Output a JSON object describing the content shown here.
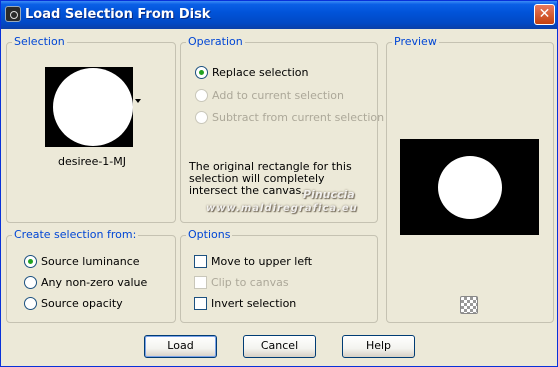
{
  "window": {
    "title": "Load Selection From Disk",
    "close_glyph": "✕"
  },
  "selection": {
    "title": "Selection",
    "name": "desiree-1-MJ"
  },
  "operation": {
    "title": "Operation",
    "options": [
      {
        "label": "Replace selection",
        "checked": true,
        "enabled": true
      },
      {
        "label": "Add to current selection",
        "checked": false,
        "enabled": false
      },
      {
        "label": "Subtract from current selection",
        "checked": false,
        "enabled": false
      }
    ],
    "info": "The original rectangle for this selection will completely intersect the canvas."
  },
  "preview": {
    "title": "Preview"
  },
  "create_from": {
    "title": "Create selection from:",
    "options": [
      {
        "label": "Source luminance",
        "checked": true
      },
      {
        "label": "Any non-zero value",
        "checked": false
      },
      {
        "label": "Source opacity",
        "checked": false
      }
    ]
  },
  "options": {
    "title": "Options",
    "checks": [
      {
        "label": "Move to upper left",
        "checked": false,
        "enabled": true
      },
      {
        "label": "Clip to canvas",
        "checked": false,
        "enabled": false
      },
      {
        "label": "Invert selection",
        "checked": false,
        "enabled": true
      }
    ]
  },
  "watermark": {
    "line1": "Pinuccia",
    "line2": "www.maldiregrafica.eu"
  },
  "buttons": {
    "load": "Load",
    "cancel": "Cancel",
    "help": "Help"
  }
}
